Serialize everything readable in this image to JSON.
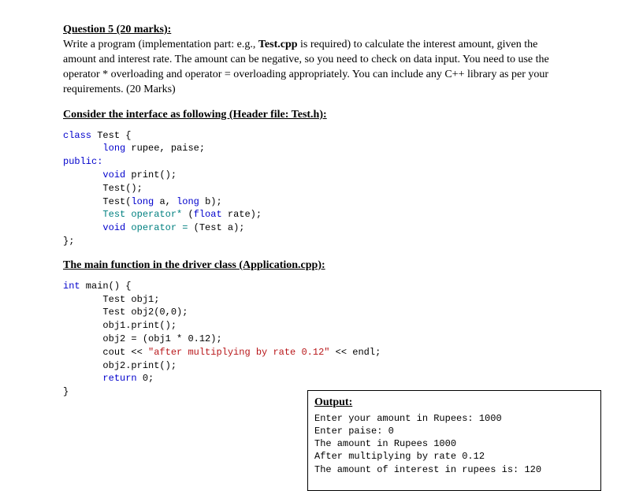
{
  "q_title": "Question 5 (20 marks):",
  "prompt_prefix": "Write a program (implementation part: e.g., ",
  "prompt_bold": "Test.cpp",
  "prompt_suffix": " is required) to calculate the interest amount, given the amount and interest rate. The amount can be negative, so you need to check on data input. You need to use the operator * overloading and operator = overloading appropriately. You can include any C++ library as per your requirements.  (20 Marks)",
  "interface_heading": "Consider the interface as following (Header file: Test.h):",
  "main_heading": "The main function in the driver class (Application.cpp):",
  "code1": {
    "l1_kw": "class",
    "l1_name": " Test {",
    "l2_pad": "       ",
    "l2_type": "long",
    "l2_vars": " rupee, paise;",
    "l3": "public:",
    "l4_pad": "       ",
    "l4_type": "void",
    "l4_fn": " print();",
    "l5_pad": "       ",
    "l5": "Test();",
    "l6_pad": "       ",
    "l6a": "Test(",
    "l6_type1": "long",
    "l6b": " a, ",
    "l6_type2": "long",
    "l6c": " b);",
    "l7_pad": "       ",
    "l7_teal": "Test operator*",
    "l7_rest": " (",
    "l7_float": "float",
    "l7_end": " rate);",
    "l8_pad": "       ",
    "l8_type": "void",
    "l8_teal": " operator =",
    "l8_rest": " (Test a);",
    "l9": "};"
  },
  "code2": {
    "l1_type": "int",
    "l1_fn": " main() {",
    "pad": "       ",
    "l2a": "Test obj1;",
    "l3a": "Test obj2(0,0);",
    "l4a": "obj1.print();",
    "l5a": "obj2 = (obj1 * 0.12);",
    "l6a": "cout << ",
    "l6_str": "\"after multiplying by rate 0.12\"",
    "l6b": " << endl;",
    "l7a": "obj2.print();",
    "l8_kw": "return",
    "l8b": " 0;",
    "l9": "}"
  },
  "output": {
    "title": "Output:",
    "l1": "Enter your amount in Rupees: 1000",
    "l2": "Enter paise: 0",
    "l3": "The amount in Rupees 1000",
    "l4": "After multiplying by rate 0.12",
    "l5": "The amount of interest in rupees is: 120"
  }
}
